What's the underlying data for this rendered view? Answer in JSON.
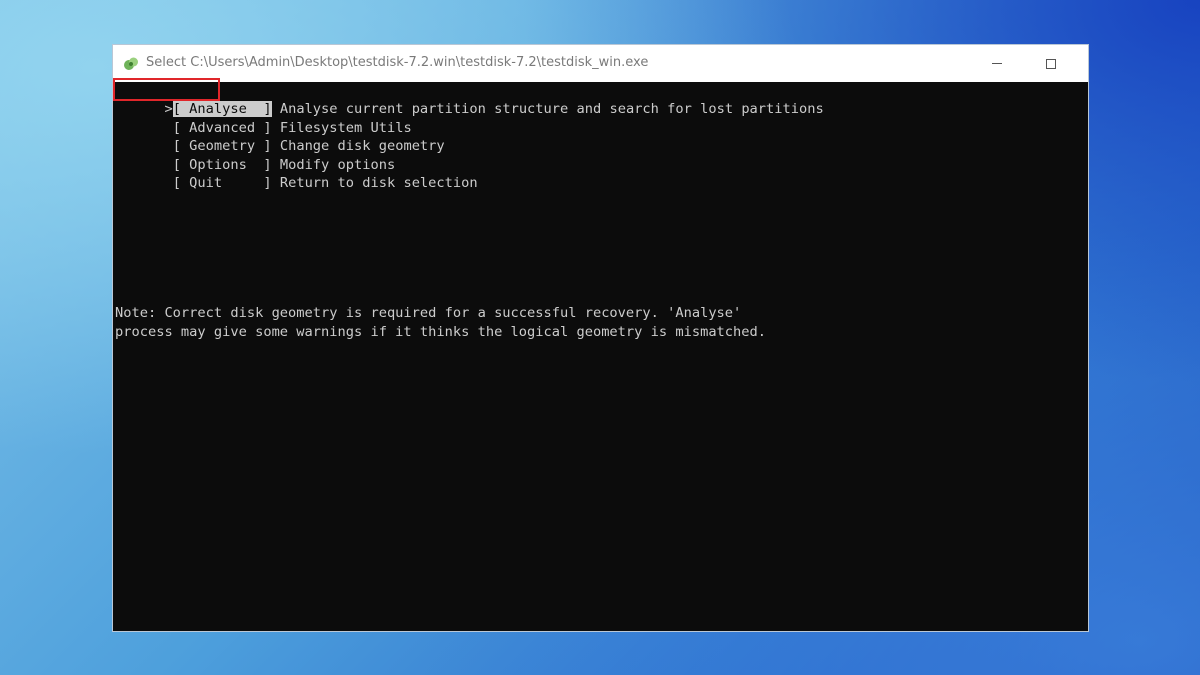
{
  "window": {
    "title": "Select C:\\Users\\Admin\\Desktop\\testdisk-7.2.win\\testdisk-7.2\\testdisk_win.exe",
    "icon": "testdisk-app-icon"
  },
  "menu": {
    "cursor": ">",
    "items": [
      {
        "label": "[ Analyse  ]",
        "description": "Analyse current partition structure and search for lost partitions",
        "selected": true
      },
      {
        "label": "[ Advanced ]",
        "description": "Filesystem Utils",
        "selected": false
      },
      {
        "label": "[ Geometry ]",
        "description": "Change disk geometry",
        "selected": false
      },
      {
        "label": "[ Options  ]",
        "description": "Modify options",
        "selected": false
      },
      {
        "label": "[ Quit     ]",
        "description": "Return to disk selection",
        "selected": false
      }
    ]
  },
  "note": {
    "line1": "Note: Correct disk geometry is required for a successful recovery. 'Analyse'",
    "line2": "process may give some warnings if it thinks the logical geometry is mismatched."
  },
  "colors": {
    "console_bg": "#0c0c0c",
    "console_text": "#cccccc",
    "highlight_box": "#e0262a"
  }
}
